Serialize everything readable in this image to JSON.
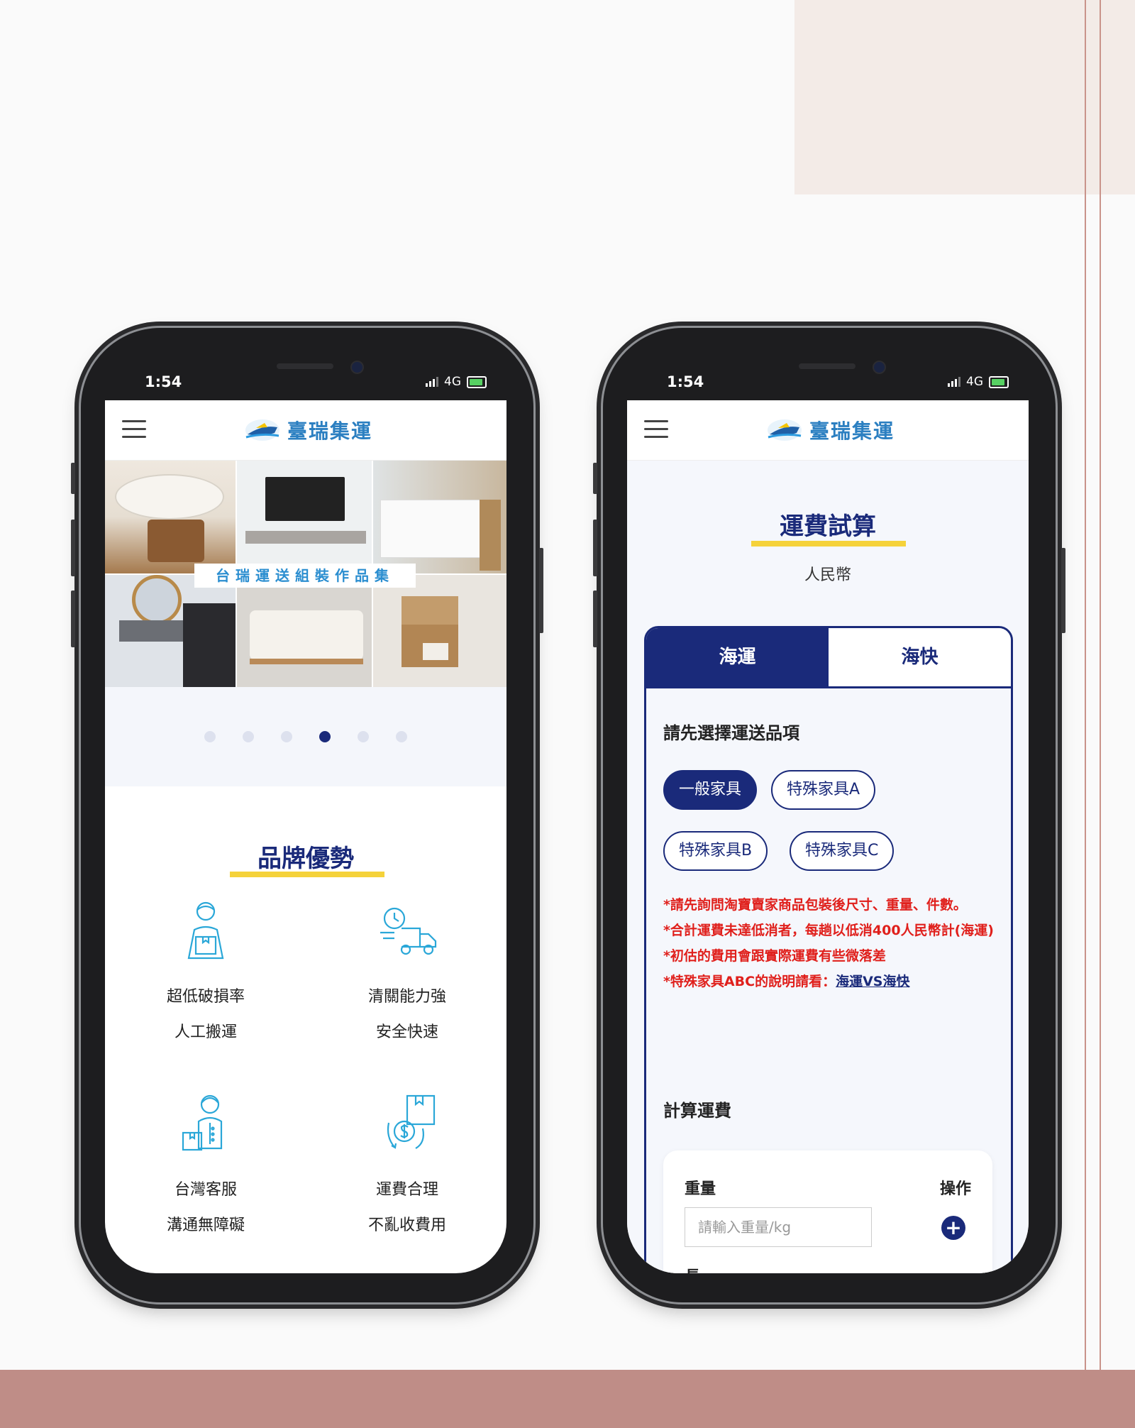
{
  "status_bar": {
    "time": "1:54",
    "network": "4G"
  },
  "brand": {
    "name": "臺瑞集運"
  },
  "left_screen": {
    "banner_caption": "台瑞運送組裝作品集",
    "carousel": {
      "dot_count": 6,
      "active_index": 3
    },
    "brand_section": {
      "title": "品牌優勢",
      "features": [
        {
          "icon": "worker-box-icon",
          "line1": "超低破損率",
          "line2": "人工搬運"
        },
        {
          "icon": "delivery-truck-clock-icon",
          "line1": "清關能力強",
          "line2": "安全快速"
        },
        {
          "icon": "customer-service-icon",
          "line1": "台灣客服",
          "line2": "溝通無障礙"
        },
        {
          "icon": "money-exchange-icon",
          "line1": "運費合理",
          "line2": "不亂收費用"
        }
      ]
    }
  },
  "right_screen": {
    "title": "運費試算",
    "currency": "人民幣",
    "tabs": [
      {
        "label": "海運",
        "active": true
      },
      {
        "label": "海快",
        "active": false
      }
    ],
    "choose_label": "請先選擇運送品項",
    "categories": [
      {
        "label": "一般家具",
        "active": true
      },
      {
        "label": "特殊家具A",
        "active": false
      },
      {
        "label": "特殊家具B",
        "active": false
      },
      {
        "label": "特殊家具C",
        "active": false
      }
    ],
    "notes": {
      "n1": "*請先詢問淘寶賣家商品包裝後尺寸、重量、件數。",
      "n2": "*合計運費未達低消者，每趟以低消400人民幣計(海運)",
      "n3": "*初估的費用會跟實際運費有些微落差",
      "n4_prefix": "*特殊家具ABC的說明請看：",
      "n4_link": "海運VS海快"
    },
    "calc": {
      "label": "計算運費",
      "weight_header": "重量",
      "action_header": "操作",
      "weight_placeholder": "請輸入重量/kg",
      "length_label": "長"
    }
  },
  "colors": {
    "navy": "#1a2a7a",
    "accent_yellow": "#f5d23a",
    "warning_red": "#e0201c",
    "logo_blue": "#2b7fc1",
    "footer_band": "#bf8d87"
  }
}
